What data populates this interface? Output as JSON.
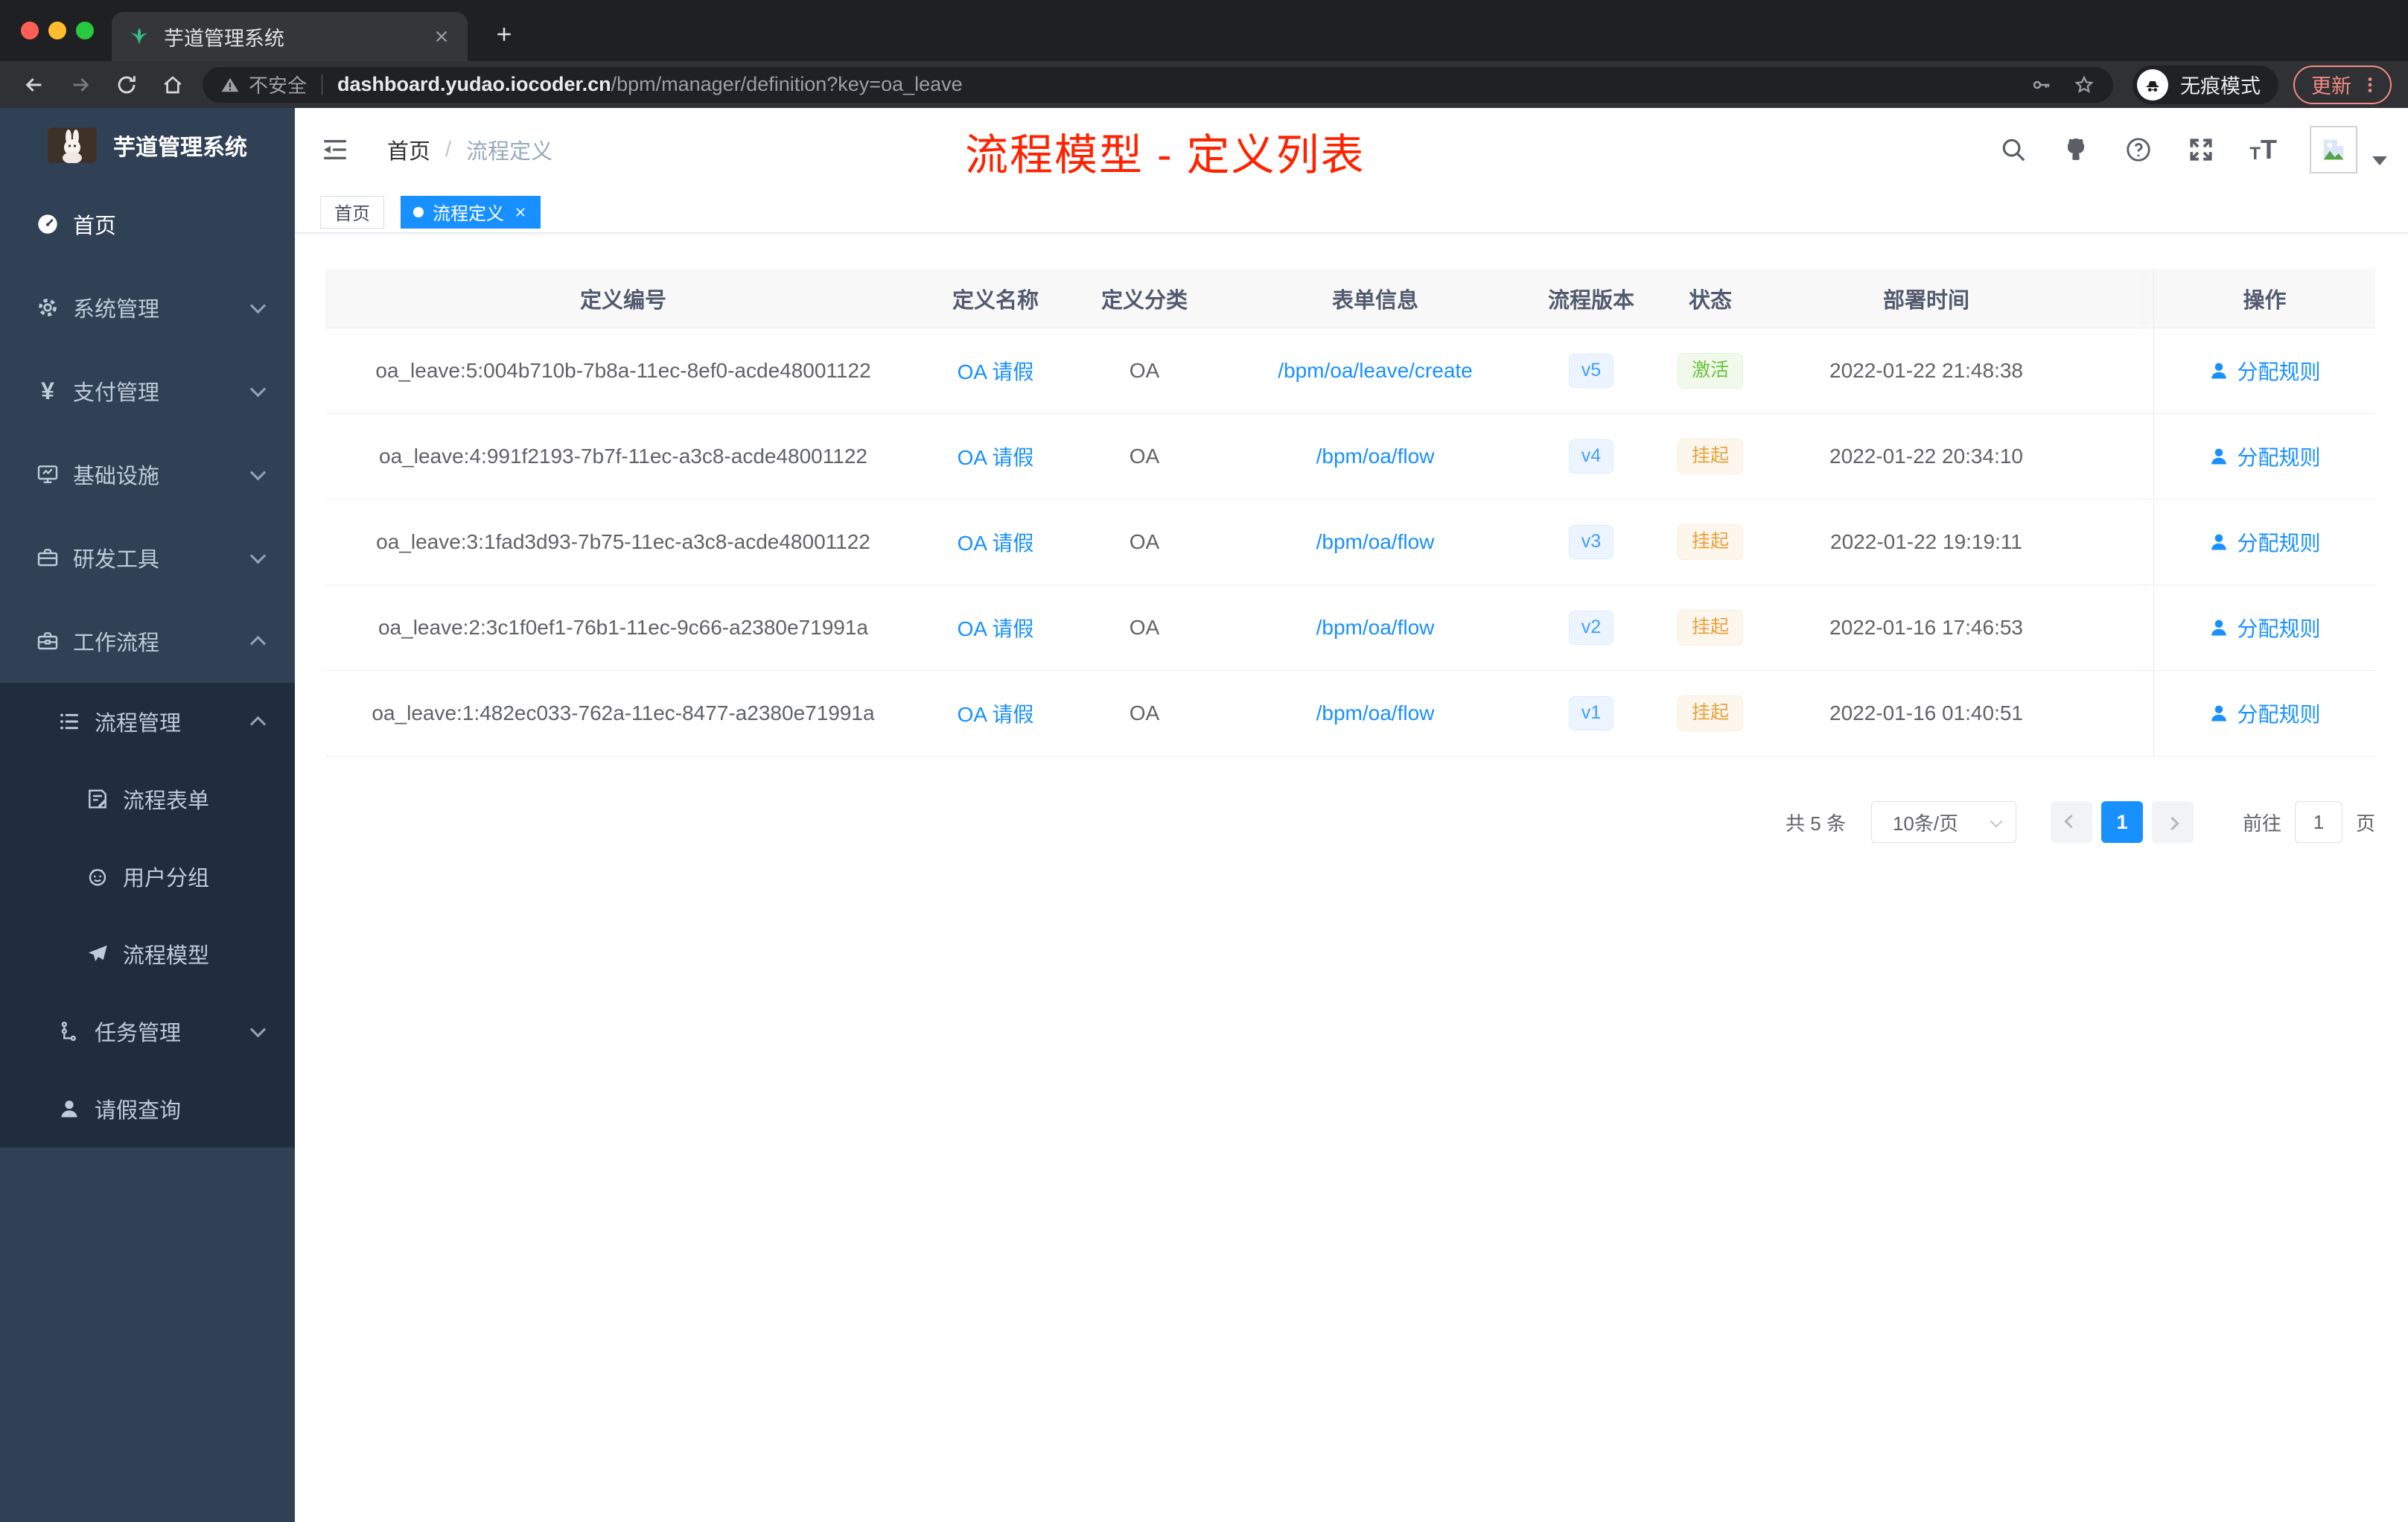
{
  "browser": {
    "tab_title": "芋道管理系统",
    "security_label": "不安全",
    "url_domain": "dashboard.yudao.iocoder.cn",
    "url_path": "/bpm/manager/definition?key=oa_leave",
    "incognito_label": "无痕模式",
    "update_label": "更新"
  },
  "sidebar": {
    "app_title": "芋道管理系统",
    "items": [
      {
        "key": "home",
        "label": "首页",
        "icon": "dashboard",
        "level": 1,
        "active": true,
        "chevron": null,
        "in_submenu": false
      },
      {
        "key": "system",
        "label": "系统管理",
        "icon": "gear",
        "level": 1,
        "chevron": "down",
        "in_submenu": false
      },
      {
        "key": "payment",
        "label": "支付管理",
        "icon": "yen",
        "level": 1,
        "chevron": "down",
        "in_submenu": false
      },
      {
        "key": "infrastructure",
        "label": "基础设施",
        "icon": "monitor",
        "level": 1,
        "chevron": "down",
        "in_submenu": false
      },
      {
        "key": "devtools",
        "label": "研发工具",
        "icon": "toolbox",
        "level": 1,
        "chevron": "down",
        "in_submenu": false
      },
      {
        "key": "workflow",
        "label": "工作流程",
        "icon": "briefcase",
        "level": 1,
        "chevron": "up",
        "in_submenu": false
      },
      {
        "key": "process-mgmt",
        "label": "流程管理",
        "icon": "list",
        "level": 2,
        "chevron": "up",
        "in_submenu": true
      },
      {
        "key": "process-form",
        "label": "流程表单",
        "icon": "form",
        "level": 3,
        "chevron": null,
        "in_submenu": true
      },
      {
        "key": "user-group",
        "label": "用户分组",
        "icon": "robot",
        "level": 3,
        "chevron": null,
        "in_submenu": true
      },
      {
        "key": "process-model",
        "label": "流程模型",
        "icon": "send",
        "level": 3,
        "chevron": null,
        "in_submenu": true
      },
      {
        "key": "task-mgmt",
        "label": "任务管理",
        "icon": "tree",
        "level": 2,
        "chevron": "down",
        "in_submenu": true
      },
      {
        "key": "leave-query",
        "label": "请假查询",
        "icon": "user",
        "level": 2,
        "chevron": null,
        "in_submenu": true
      }
    ]
  },
  "header": {
    "breadcrumb": {
      "home": "首页",
      "separator": "/",
      "current": "流程定义"
    },
    "annotation": "流程模型 - 定义列表"
  },
  "tags": {
    "home": "首页",
    "current": "流程定义"
  },
  "table": {
    "columns": [
      "定义编号",
      "定义名称",
      "定义分类",
      "表单信息",
      "流程版本",
      "状态",
      "部署时间",
      "操作"
    ],
    "rows": [
      {
        "id": "oa_leave:5:004b710b-7b8a-11ec-8ef0-acde48001122",
        "name": "OA 请假",
        "category": "OA",
        "form": "/bpm/oa/leave/create",
        "version": "v5",
        "status": "激活",
        "status_type": "success",
        "time": "2022-01-22 21:48:38",
        "action": "分配规则"
      },
      {
        "id": "oa_leave:4:991f2193-7b7f-11ec-a3c8-acde48001122",
        "name": "OA 请假",
        "category": "OA",
        "form": "/bpm/oa/flow",
        "version": "v4",
        "status": "挂起",
        "status_type": "warning",
        "time": "2022-01-22 20:34:10",
        "action": "分配规则"
      },
      {
        "id": "oa_leave:3:1fad3d93-7b75-11ec-a3c8-acde48001122",
        "name": "OA 请假",
        "category": "OA",
        "form": "/bpm/oa/flow",
        "version": "v3",
        "status": "挂起",
        "status_type": "warning",
        "time": "2022-01-22 19:19:11",
        "action": "分配规则"
      },
      {
        "id": "oa_leave:2:3c1f0ef1-76b1-11ec-9c66-a2380e71991a",
        "name": "OA 请假",
        "category": "OA",
        "form": "/bpm/oa/flow",
        "version": "v2",
        "status": "挂起",
        "status_type": "warning",
        "time": "2022-01-16 17:46:53",
        "action": "分配规则"
      },
      {
        "id": "oa_leave:1:482ec033-762a-11ec-8477-a2380e71991a",
        "name": "OA 请假",
        "category": "OA",
        "form": "/bpm/oa/flow",
        "version": "v1",
        "status": "挂起",
        "status_type": "warning",
        "time": "2022-01-16 01:40:51",
        "action": "分配规则"
      }
    ]
  },
  "pagination": {
    "total_text": "共 5 条",
    "page_size": "10条/页",
    "current_page": "1",
    "goto_label": "前往",
    "goto_value": "1",
    "page_unit": "页"
  },
  "colors": {
    "accent_blue": "#1890ff",
    "element_blue": "#409eff",
    "success_green": "#67c23a",
    "warning_orange": "#e6a23c",
    "sidebar_bg": "#304156",
    "submenu_bg": "#1f2d3d",
    "annotation_red": "#ff2200"
  }
}
